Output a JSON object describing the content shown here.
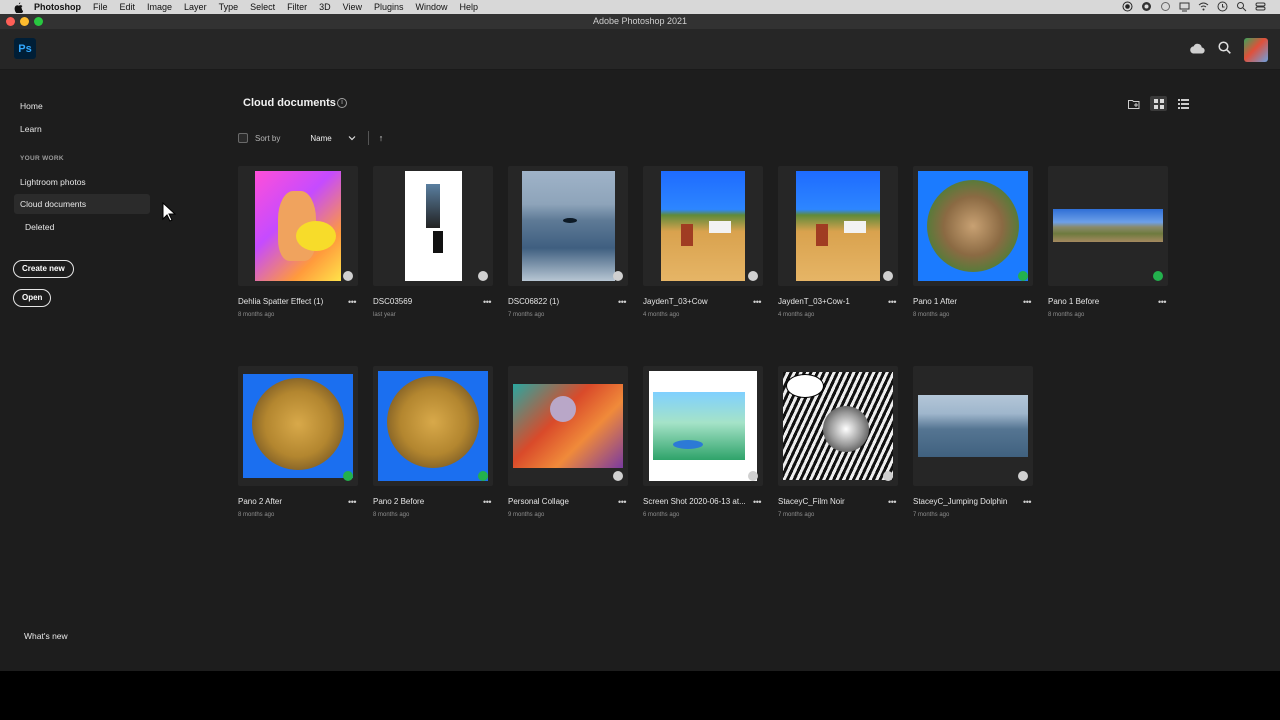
{
  "menubar": {
    "app": "Photoshop",
    "items": [
      "File",
      "Edit",
      "Image",
      "Layer",
      "Type",
      "Select",
      "Filter",
      "3D",
      "View",
      "Plugins",
      "Window",
      "Help"
    ]
  },
  "window": {
    "title": "Adobe Photoshop 2021"
  },
  "header": {
    "logo": "Ps"
  },
  "sidebar": {
    "home": "Home",
    "learn": "Learn",
    "section": "YOUR WORK",
    "lightroom": "Lightroom photos",
    "cloud_docs": "Cloud documents",
    "deleted": "Deleted",
    "create_new": "Create new",
    "open": "Open",
    "whats_new": "What's new"
  },
  "content": {
    "title": "Cloud documents",
    "sort_label": "Sort by",
    "sort_value": "Name"
  },
  "documents": [
    {
      "name": "Dehlia Spatter Effect (1)",
      "date": "8 months ago",
      "status": "cloud"
    },
    {
      "name": "DSC03569",
      "date": "last year",
      "status": "cloud"
    },
    {
      "name": "DSC06822 (1)",
      "date": "7 months ago",
      "status": "cloud"
    },
    {
      "name": "JaydenT_03+Cow",
      "date": "4 months ago",
      "status": "cloud"
    },
    {
      "name": "JaydenT_03+Cow-1",
      "date": "4 months ago",
      "status": "cloud"
    },
    {
      "name": "Pano 1 After",
      "date": "8 months ago",
      "status": "synced"
    },
    {
      "name": "Pano 1 Before",
      "date": "8 months ago",
      "status": "synced"
    },
    {
      "name": "Pano 2 After",
      "date": "8 months ago",
      "status": "synced"
    },
    {
      "name": "Pano 2 Before",
      "date": "8 months ago",
      "status": "synced"
    },
    {
      "name": "Personal Collage",
      "date": "9 months ago",
      "status": "cloud"
    },
    {
      "name": "Screen Shot 2020-06-13 at...",
      "date": "6 months ago",
      "status": "cloud"
    },
    {
      "name": "StaceyC_Film Noir",
      "date": "7 months ago",
      "status": "cloud"
    },
    {
      "name": "StaceyC_Jumping Dolphin",
      "date": "7 months ago",
      "status": "cloud"
    }
  ]
}
